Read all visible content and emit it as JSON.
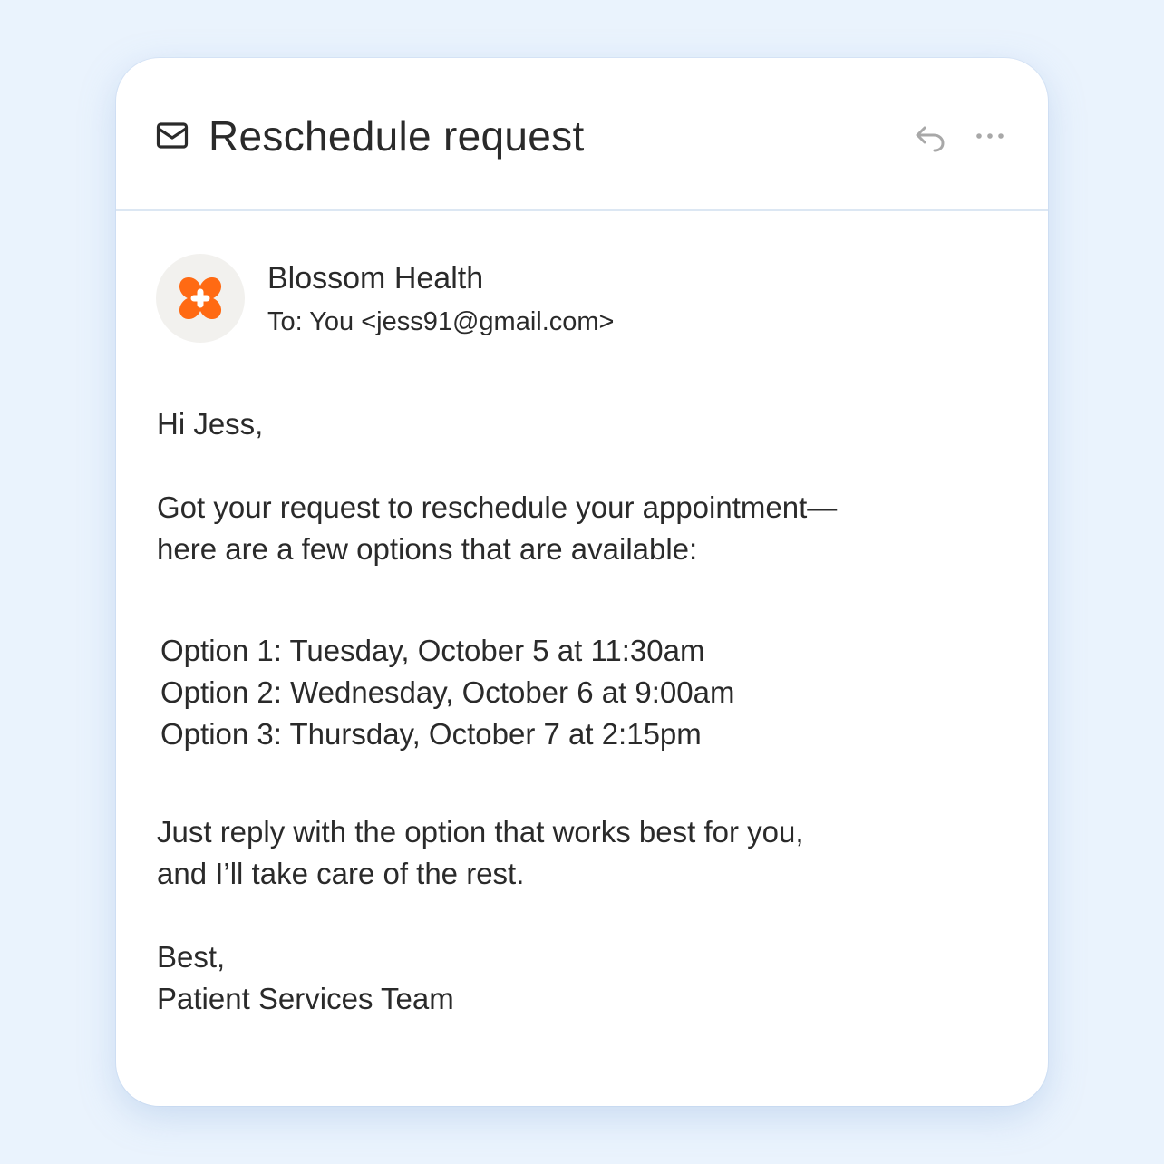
{
  "email": {
    "subject": "Reschedule request",
    "sender": {
      "name": "Blossom Health",
      "to_line": "To: You <jess91@gmail.com>",
      "logo_color": "#ff6a13"
    },
    "body": {
      "greeting": "Hi Jess,",
      "intro_lines": [
        "Got your request to reschedule your appointment—",
        "here are a few options that are available:"
      ],
      "options": [
        "Option 1: Tuesday, October 5 at 11:30am",
        "Option 2: Wednesday, October 6 at 9:00am",
        "Option 3: Thursday, October 7 at 2:15pm"
      ],
      "closing_lines": [
        "Just reply with the option that works best for you,",
        "and I’ll take care of the rest."
      ],
      "signoff_lines": [
        "Best,",
        "Patient Services Team"
      ]
    }
  },
  "toolbar": {
    "reply_icon": "reply-icon",
    "more_icon": "more-horizontal-icon",
    "mail_icon": "mail-icon"
  },
  "colors": {
    "background": "#eaf3fd",
    "card": "#ffffff",
    "text": "#2a2a2a",
    "icon_muted": "#a8a8a8",
    "divider": "#dce7f3",
    "brand": "#ff6a13"
  }
}
